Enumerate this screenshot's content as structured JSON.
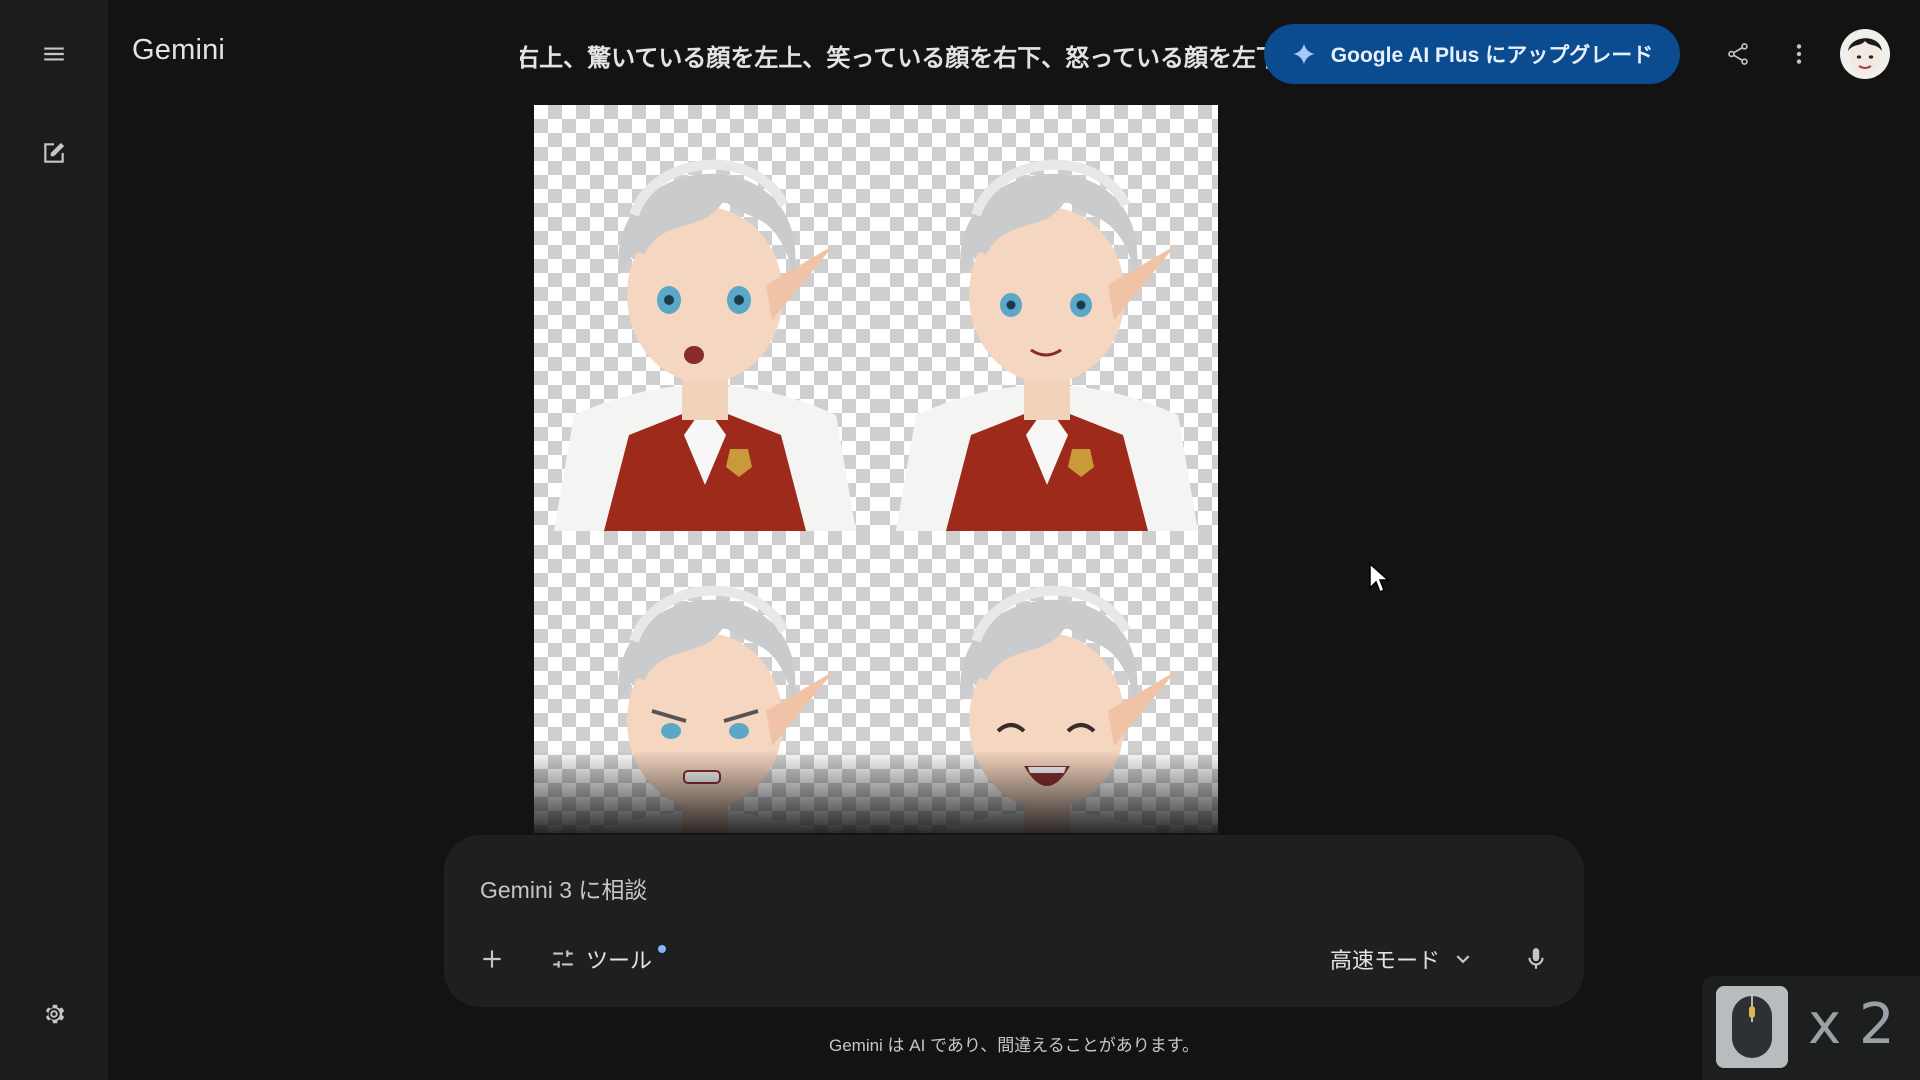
{
  "app": {
    "title": "Gemini"
  },
  "conversation": {
    "title": "右上、驚いている顔を左上、笑っている顔を右下、怒っている顔を左下"
  },
  "header": {
    "upgrade_label": "Google AI Plus にアップグレード"
  },
  "gallery": {
    "tiles": [
      {
        "expression": "surprised"
      },
      {
        "expression": "smiling"
      },
      {
        "expression": "angry"
      },
      {
        "expression": "laughing"
      }
    ]
  },
  "composer": {
    "placeholder": "Gemini 3 に相談",
    "tools_label": "ツール",
    "mode_label": "高速モード"
  },
  "footer": {
    "disclaimer": "Gemini は AI であり、間違えることがあります。"
  },
  "overlay": {
    "click_count": "x 2"
  },
  "icons": {
    "menu": "menu-icon",
    "new_chat": "edit-icon",
    "settings": "gear-icon",
    "share": "share-icon",
    "more": "more-vert-icon",
    "sparkle": "sparkle-icon",
    "add": "plus-icon",
    "tools": "tune-icon",
    "chevron": "chevron-down-icon",
    "mic": "mic-icon"
  },
  "colors": {
    "background": "#131314",
    "rail": "#1b1c1d",
    "composer": "#1e1f20",
    "upgrade_button": "#0b4b8f",
    "text": "#e3e3e3"
  }
}
